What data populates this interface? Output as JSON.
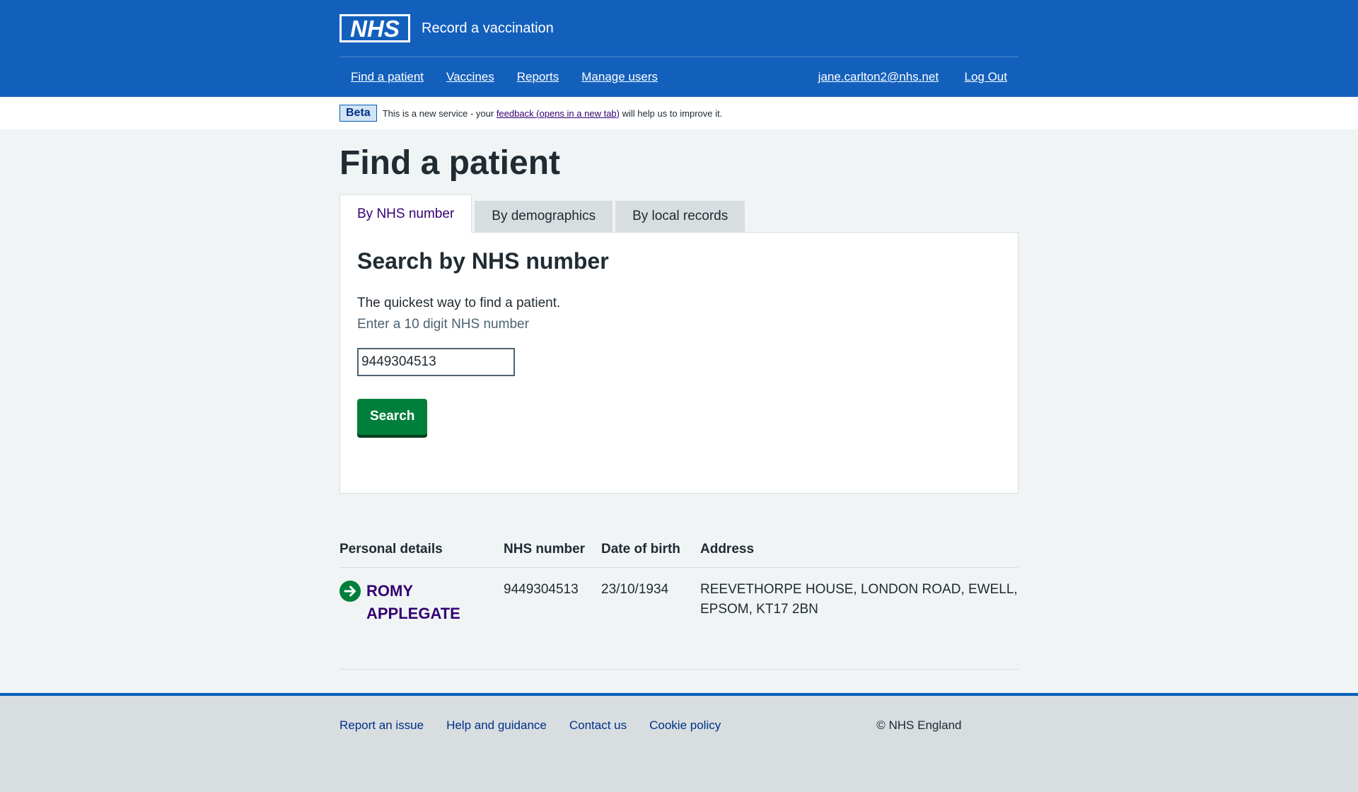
{
  "header": {
    "logo_text": "NHS",
    "service_name": "Record a vaccination",
    "nav": [
      "Find a patient",
      "Vaccines",
      "Reports",
      "Manage users"
    ],
    "user_email": "jane.carlton2@nhs.net",
    "logout": "Log Out"
  },
  "beta": {
    "tag": "Beta",
    "text_before": "This is a new service - your",
    "link": "feedback (opens in a new tab)",
    "text_after": "will help us to improve it."
  },
  "page_title": "Find a patient",
  "tabs": [
    "By NHS number",
    "By demographics",
    "By local records"
  ],
  "panel": {
    "heading": "Search by NHS number",
    "intro": "The quickest way to find a patient.",
    "hint": "Enter a 10 digit NHS number",
    "input_value": "9449304513",
    "search_button": "Search"
  },
  "results": {
    "headers": [
      "Personal details",
      "NHS number",
      "Date of birth",
      "Address"
    ],
    "rows": [
      {
        "name_line1": "ROMY",
        "name_line2": "APPLEGATE",
        "nhs_number": "9449304513",
        "dob": "23/10/1934",
        "address_line1": "REEVETHORPE HOUSE, LONDON ROAD, EWELL,",
        "address_line2": "EPSOM, KT17 2BN"
      }
    ]
  },
  "footer": {
    "links": [
      "Report an issue",
      "Help and guidance",
      "Contact us",
      "Cookie policy"
    ],
    "copyright": "© NHS England"
  },
  "colors": {
    "header_blue": "#1360bc",
    "button_green": "#007f3b",
    "link_purple": "#330072"
  }
}
